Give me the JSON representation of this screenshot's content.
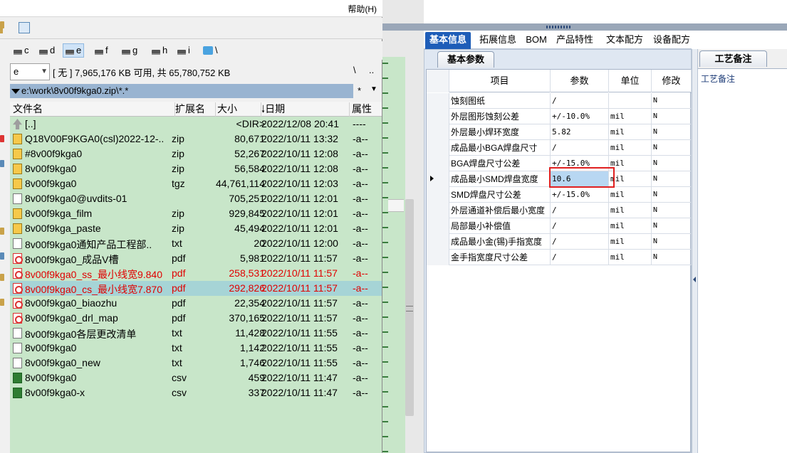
{
  "left": {
    "menu": {
      "help": "帮助(H)"
    },
    "drives": [
      {
        "letter": "c",
        "active": false
      },
      {
        "letter": "d",
        "active": false
      },
      {
        "letter": "e",
        "active": true
      },
      {
        "letter": "f",
        "active": false
      },
      {
        "letter": "g",
        "active": false
      },
      {
        "letter": "h",
        "active": false
      },
      {
        "letter": "i",
        "active": false
      },
      {
        "letter": "\\",
        "active": false
      }
    ],
    "drive_select": "e",
    "free_space_text": "[ 无 ]  7,965,176 KB 可用, 共 65,780,752 KB",
    "root_button": "\\",
    "up_button": "..",
    "path": "e:\\work\\8v00f9kga0.zip\\*.*",
    "filter_button": "*",
    "columns": {
      "name": "文件名",
      "ext": "扩展名",
      "size": "大小",
      "date": "日期",
      "attr": "属性"
    },
    "files": [
      {
        "icon": "up",
        "name": "[..]",
        "ext": "",
        "size": "<DIR>",
        "date": "2022/12/08 20:41",
        "attr": "----",
        "style": ""
      },
      {
        "icon": "zip",
        "name": "Q18V00F9KGA0(csl)2022-12-..",
        "ext": "zip",
        "size": "80,671",
        "date": "2022/10/11 13:32",
        "attr": "-a--",
        "style": ""
      },
      {
        "icon": "zip",
        "name": "#8v00f9kga0",
        "ext": "zip",
        "size": "52,267",
        "date": "2022/10/11 12:08",
        "attr": "-a--",
        "style": ""
      },
      {
        "icon": "zip",
        "name": "8v00f9kga0",
        "ext": "zip",
        "size": "56,584",
        "date": "2022/10/11 12:08",
        "attr": "-a--",
        "style": ""
      },
      {
        "icon": "zip",
        "name": "8v00f9kga0",
        "ext": "tgz",
        "size": "44,761,114",
        "date": "2022/10/11 12:03",
        "attr": "-a--",
        "style": ""
      },
      {
        "icon": "txt",
        "name": "8v00f9kga0@uvdits-01",
        "ext": "",
        "size": "705,251",
        "date": "2022/10/11 12:01",
        "attr": "-a--",
        "style": ""
      },
      {
        "icon": "zip",
        "name": "8v00f9kga_film",
        "ext": "zip",
        "size": "929,845",
        "date": "2022/10/11 12:01",
        "attr": "-a--",
        "style": ""
      },
      {
        "icon": "zip",
        "name": "8v00f9kga_paste",
        "ext": "zip",
        "size": "45,494",
        "date": "2022/10/11 12:01",
        "attr": "-a--",
        "style": ""
      },
      {
        "icon": "txt",
        "name": "8v00f9kga0通知产品工程部..",
        "ext": "txt",
        "size": "20",
        "date": "2022/10/11 12:00",
        "attr": "-a--",
        "style": ""
      },
      {
        "icon": "pdf",
        "name": "8v00f9kga0_成品V槽",
        "ext": "pdf",
        "size": "5,981",
        "date": "2022/10/11 11:57",
        "attr": "-a--",
        "style": ""
      },
      {
        "icon": "pdf",
        "name": "8v00f9kga0_ss_最小线宽9.840",
        "ext": "pdf",
        "size": "258,531",
        "date": "2022/10/11 11:57",
        "attr": "-a--",
        "style": "red"
      },
      {
        "icon": "pdf",
        "name": "8v00f9kga0_cs_最小线宽7.870",
        "ext": "pdf",
        "size": "292,826",
        "date": "2022/10/11 11:57",
        "attr": "-a--",
        "style": "red selected"
      },
      {
        "icon": "pdf",
        "name": "8v00f9kga0_biaozhu",
        "ext": "pdf",
        "size": "22,354",
        "date": "2022/10/11 11:57",
        "attr": "-a--",
        "style": ""
      },
      {
        "icon": "pdf",
        "name": "8v00f9kga0_drl_map",
        "ext": "pdf",
        "size": "370,165",
        "date": "2022/10/11 11:57",
        "attr": "-a--",
        "style": ""
      },
      {
        "icon": "txt",
        "name": "8v00f9kga0各层更改清单",
        "ext": "txt",
        "size": "11,428",
        "date": "2022/10/11 11:55",
        "attr": "-a--",
        "style": ""
      },
      {
        "icon": "txt",
        "name": "8v00f9kga0",
        "ext": "txt",
        "size": "1,142",
        "date": "2022/10/11 11:55",
        "attr": "-a--",
        "style": ""
      },
      {
        "icon": "txt",
        "name": "8v00f9kga0_new",
        "ext": "txt",
        "size": "1,746",
        "date": "2022/10/11 11:55",
        "attr": "-a--",
        "style": ""
      },
      {
        "icon": "csv",
        "name": "8v00f9kga0",
        "ext": "csv",
        "size": "459",
        "date": "2022/10/11 11:47",
        "attr": "-a--",
        "style": ""
      },
      {
        "icon": "csv",
        "name": "8v00f9kga0-x",
        "ext": "csv",
        "size": "337",
        "date": "2022/10/11 11:47",
        "attr": "-a--",
        "style": ""
      }
    ]
  },
  "right": {
    "tabs": [
      "基本信息",
      "拓展信息",
      "BOM",
      "产品特性",
      "文本配方",
      "设备配方"
    ],
    "active_tab": 0,
    "subtab": "基本参数",
    "grid_columns": {
      "item": "项目",
      "param": "参数",
      "unit": "单位",
      "modify": "修改"
    },
    "rows": [
      {
        "item": "蚀刻图纸",
        "param": "/",
        "unit": "",
        "modify": "N",
        "current": false
      },
      {
        "item": "外层图形蚀刻公差",
        "param": "+/-10.0%",
        "unit": "mil",
        "modify": "N",
        "current": false
      },
      {
        "item": "外层最小焊环宽度",
        "param": "5.82",
        "unit": "mil",
        "modify": "N",
        "current": false
      },
      {
        "item": "成品最小BGA焊盘尺寸",
        "param": "/",
        "unit": "mil",
        "modify": "N",
        "current": false
      },
      {
        "item": "BGA焊盘尺寸公差",
        "param": "+/-15.0%",
        "unit": "mil",
        "modify": "N",
        "current": false
      },
      {
        "item": "成品最小SMD焊盘宽度",
        "param": "10.6",
        "unit": "mil",
        "modify": "N",
        "current": true
      },
      {
        "item": "SMD焊盘尺寸公差",
        "param": "+/-15.0%",
        "unit": "mil",
        "modify": "N",
        "current": false
      },
      {
        "item": "外层通道补偿后最小宽度",
        "param": "/",
        "unit": "mil",
        "modify": "N",
        "current": false
      },
      {
        "item": "局部最小补偿值",
        "param": "/",
        "unit": "mil",
        "modify": "N",
        "current": false
      },
      {
        "item": "成品最小金(锡)手指宽度",
        "param": "/",
        "unit": "mil",
        "modify": "N",
        "current": false
      },
      {
        "item": "金手指宽度尺寸公差",
        "param": "/",
        "unit": "mil",
        "modify": "N",
        "current": false
      }
    ],
    "notes_tab": "工艺备注",
    "notes_label": "工艺备注"
  },
  "colors": {
    "list_bg": "#c8e6c9",
    "selected_row": "#a6d4d6",
    "red_text": "#e00000",
    "active_tab": "#1e5db8",
    "highlight_box": "#e02020"
  }
}
